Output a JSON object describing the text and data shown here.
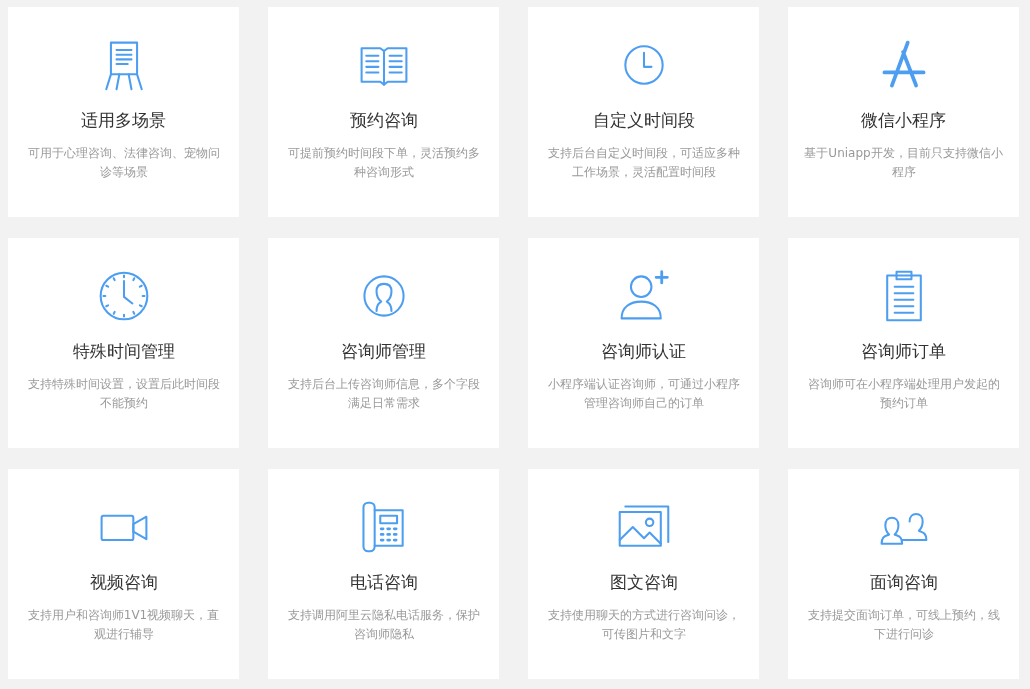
{
  "cards": [
    {
      "kind": "easel",
      "title": "适用多场景",
      "desc": "可用于心理咨询、法律咨询、宠物问诊等场景"
    },
    {
      "kind": "book",
      "title": "预约咨询",
      "desc": "可提前预约时间段下单，灵活预约多种咨询形式"
    },
    {
      "kind": "clock",
      "title": "自定义时间段",
      "desc": "支持后台自定义时间段，可适应多种工作场景，灵活配置时间段"
    },
    {
      "kind": "appstore",
      "title": "微信小程序",
      "desc": "基于Uniapp开发，目前只支持微信小程序"
    },
    {
      "kind": "wallclock",
      "title": "特殊时间管理",
      "desc": "支持特殊时间设置，设置后此时间段不能预约"
    },
    {
      "kind": "user",
      "title": "咨询师管理",
      "desc": "支持后台上传咨询师信息，多个字段满足日常需求"
    },
    {
      "kind": "useradd",
      "title": "咨询师认证",
      "desc": "小程序端认证咨询师，可通过小程序管理咨询师自己的订单"
    },
    {
      "kind": "clipboard",
      "title": "咨询师订单",
      "desc": "咨询师可在小程序端处理用户发起的预约订单"
    },
    {
      "kind": "video",
      "title": "视频咨询",
      "desc": "支持用户和咨询师1V1视频聊天，直观进行辅导"
    },
    {
      "kind": "phone",
      "title": "电话咨询",
      "desc": "支持调用阿里云隐私电话服务，保护咨询师隐私"
    },
    {
      "kind": "gallery",
      "title": "图文咨询",
      "desc": "支持使用聊天的方式进行咨询问诊，可传图片和文字"
    },
    {
      "kind": "users",
      "title": "面询咨询",
      "desc": "支持提交面询订单，可线上预约，线下进行问诊"
    }
  ]
}
